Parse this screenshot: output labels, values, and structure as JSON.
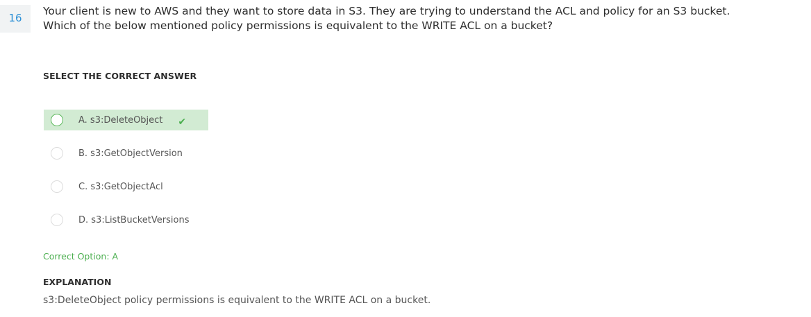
{
  "question": {
    "number": "16",
    "line1": "Your client is new to AWS and they want to store data in S3. They are trying to understand the ACL and policy for an S3 bucket.",
    "line2": "Which of the below mentioned policy permissions is equivalent to the WRITE ACL on a bucket?"
  },
  "answers": {
    "heading": "SELECT THE CORRECT ANSWER",
    "options": [
      {
        "label": "A. s3:DeleteObject",
        "correct": true,
        "icon": "check-icon"
      },
      {
        "label": "B. s3:GetObjectVersion",
        "correct": false
      },
      {
        "label": "C. s3:GetObjectAcl",
        "correct": false
      },
      {
        "label": "D. s3:ListBucketVersions",
        "correct": false
      }
    ]
  },
  "result": {
    "correct_option": "Correct Option: A",
    "correct_color": "#4caf50",
    "highlight_color": "#d2ebd3"
  },
  "explanation": {
    "heading": "EXPLANATION",
    "text": "s3:DeleteObject policy permissions is equivalent to the WRITE ACL on a bucket."
  }
}
